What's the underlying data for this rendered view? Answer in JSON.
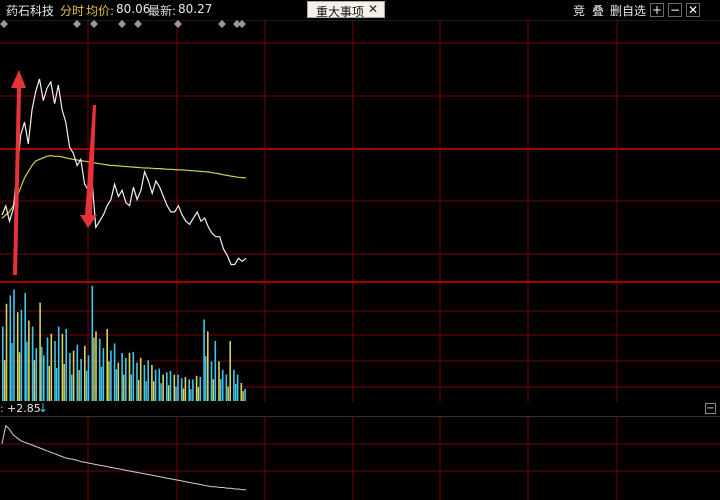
{
  "header": {
    "stock_name": "药石科技",
    "mode": "分时",
    "avg_label": "均价:",
    "avg_value": "80.06",
    "latest_label": "最新:",
    "latest_value": "80.27",
    "tab_label": "重大事项",
    "tab_close": "✕",
    "tool_bid": "竞",
    "tool_overlay": "叠",
    "tool_remove_fav": "删自选",
    "plus": "+",
    "minus": "−",
    "zoom_out": "✕"
  },
  "subpanel": {
    "prefix": ":",
    "value": "+2.85",
    "arrow": "↓",
    "toggle": "−"
  },
  "colors": {
    "grid": "#7a0000",
    "price": "#f0f0f0",
    "avg": "#cdd150",
    "vol_cyan": "#3ec7f0",
    "vol_yellow": "#d9d25a",
    "annotation": "#e8323a"
  },
  "chart_data": {
    "type": "line",
    "price_series": [
      78.6,
      78.9,
      78.4,
      78.8,
      80.0,
      81.2,
      81.6,
      80.9,
      82.0,
      82.6,
      83.0,
      82.3,
      82.7,
      82.9,
      82.2,
      82.8,
      82.0,
      81.6,
      80.8,
      80.6,
      80.2,
      80.4,
      79.6,
      79.4,
      79.7,
      78.2,
      78.4,
      78.6,
      78.9,
      79.1,
      79.6,
      79.2,
      79.4,
      79.0,
      78.9,
      79.5,
      79.1,
      79.4,
      80.0,
      79.7,
      79.3,
      79.7,
      79.5,
      79.2,
      78.9,
      78.7,
      78.7,
      78.9,
      78.6,
      78.4,
      78.3,
      78.5,
      78.7,
      78.4,
      78.5,
      78.2,
      78.0,
      77.9,
      77.9,
      77.5,
      77.3,
      77.0,
      77.0,
      77.2,
      77.1,
      77.2
    ],
    "avg_series": [
      78.5,
      78.6,
      78.7,
      78.9,
      79.2,
      79.5,
      79.8,
      80.0,
      80.2,
      80.35,
      80.4,
      80.45,
      80.5,
      80.52,
      80.5,
      80.5,
      80.48,
      80.45,
      80.42,
      80.4,
      80.38,
      80.36,
      80.34,
      80.32,
      80.3,
      80.28,
      80.26,
      80.24,
      80.22,
      80.2,
      80.2,
      80.19,
      80.18,
      80.17,
      80.16,
      80.15,
      80.14,
      80.13,
      80.12,
      80.12,
      80.11,
      80.1,
      80.1,
      80.09,
      80.08,
      80.08,
      80.07,
      80.06,
      80.06,
      80.05,
      80.04,
      80.03,
      80.02,
      80.01,
      80.0,
      79.99,
      79.97,
      79.95,
      79.93,
      79.9,
      79.88,
      79.86,
      79.84,
      79.82,
      79.81,
      79.8
    ],
    "volume_series": [
      0.62,
      0.81,
      0.88,
      0.93,
      0.74,
      0.76,
      0.9,
      0.67,
      0.62,
      0.44,
      0.82,
      0.38,
      0.53,
      0.56,
      0.5,
      0.62,
      0.56,
      0.6,
      0.4,
      0.42,
      0.47,
      0.35,
      0.46,
      0.38,
      0.96,
      0.58,
      0.52,
      0.44,
      0.6,
      0.42,
      0.48,
      0.32,
      0.4,
      0.36,
      0.4,
      0.41,
      0.32,
      0.36,
      0.3,
      0.34,
      0.3,
      0.26,
      0.27,
      0.22,
      0.24,
      0.25,
      0.22,
      0.22,
      0.19,
      0.2,
      0.18,
      0.18,
      0.21,
      0.2,
      0.68,
      0.58,
      0.33,
      0.5,
      0.33,
      0.26,
      0.22,
      0.5,
      0.26,
      0.22,
      0.15,
      0.1
    ],
    "index_series": [
      0.7,
      0.95,
      0.9,
      0.82,
      0.78,
      0.74,
      0.72,
      0.7,
      0.68,
      0.66,
      0.64,
      0.62,
      0.6,
      0.58,
      0.56,
      0.54,
      0.52,
      0.5,
      0.49,
      0.48,
      0.47,
      0.45,
      0.44,
      0.43,
      0.42,
      0.41,
      0.4,
      0.39,
      0.38,
      0.37,
      0.36,
      0.35,
      0.34,
      0.33,
      0.32,
      0.31,
      0.3,
      0.29,
      0.28,
      0.27,
      0.26,
      0.25,
      0.24,
      0.23,
      0.22,
      0.21,
      0.2,
      0.19,
      0.18,
      0.17,
      0.16,
      0.15,
      0.14,
      0.13,
      0.12,
      0.11,
      0.1,
      0.1,
      0.09,
      0.09,
      0.08,
      0.08,
      0.07,
      0.07,
      0.06,
      0.06
    ],
    "price_range": [
      76.5,
      84.0
    ],
    "grid": true
  }
}
